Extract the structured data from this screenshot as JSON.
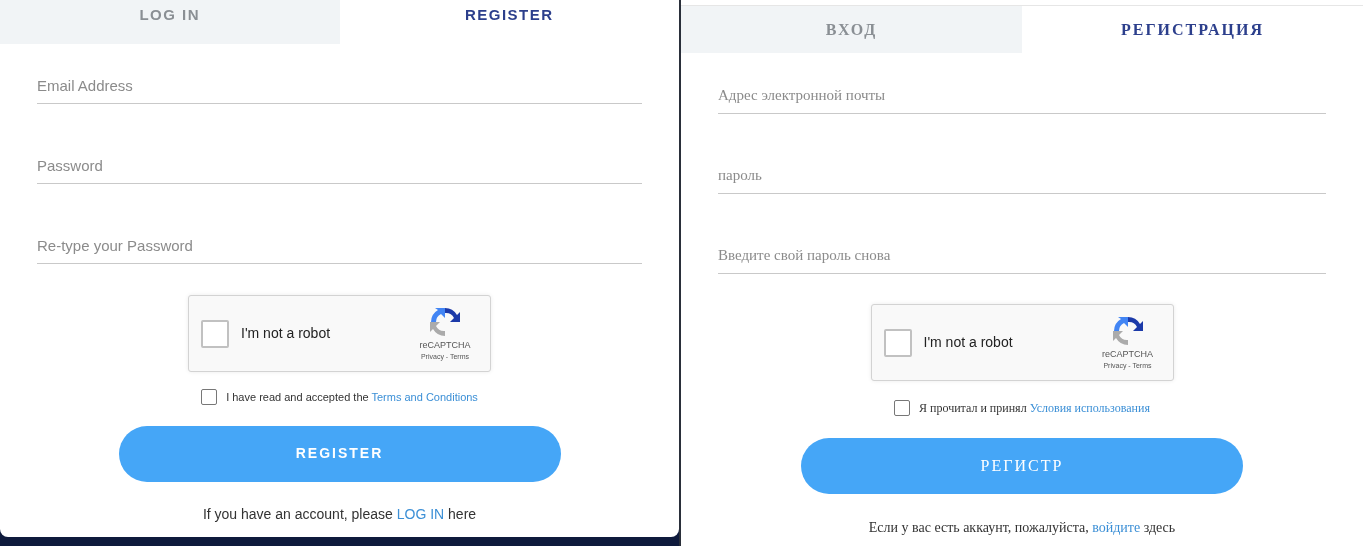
{
  "panels": [
    {
      "tabs": [
        {
          "label": "LOG IN",
          "selected": false
        },
        {
          "label": "REGISTER",
          "selected": true
        }
      ],
      "fields": [
        {
          "placeholder": "Email Address"
        },
        {
          "placeholder": "Password"
        },
        {
          "placeholder": "Re-type your Password"
        }
      ],
      "captcha": {
        "label": "I'm not a robot",
        "checked": false,
        "brand": "reCAPTCHA",
        "links": "Privacy - Terms"
      },
      "terms": {
        "checked": false,
        "text": "I have read and accepted the",
        "link": "Terms and Conditions"
      },
      "button": "REGISTER",
      "footer": {
        "text_before": "If you have an account, please",
        "link": "LOG IN",
        "text_after": "here"
      }
    },
    {
      "tabs": [
        {
          "label": "ВХОД",
          "selected": false
        },
        {
          "label": "РЕГИСТРАЦИЯ",
          "selected": true
        }
      ],
      "fields": [
        {
          "placeholder": "Адрес электронной почты"
        },
        {
          "placeholder": "пароль"
        },
        {
          "placeholder": "Введите свой пароль снова"
        }
      ],
      "captcha": {
        "label": "I'm not a robot",
        "checked": false,
        "brand": "reCAPTCHA",
        "links": "Privacy - Terms"
      },
      "terms": {
        "checked": false,
        "text": "Я прочитал и принял",
        "link": "Условия использования"
      },
      "button": "РЕГИСТР",
      "footer": {
        "text_before": "Если у вас есть аккаунт, пожалуйста,",
        "link": "войдите",
        "text_after": "здесь"
      }
    }
  ]
}
